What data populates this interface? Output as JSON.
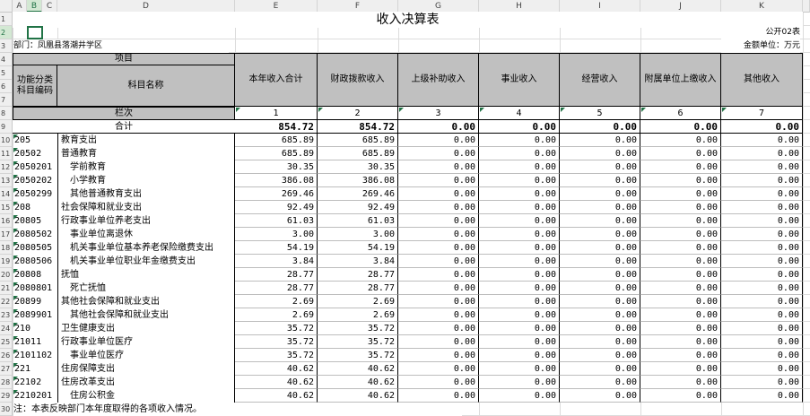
{
  "title": "收入决算表",
  "form_no": "公开02表",
  "dept_label": "部门：凤凰县落潮井学区",
  "unit_label": "金额单位：万元",
  "column_letters": [
    "A",
    "B",
    "C",
    "D",
    "E",
    "F",
    "G",
    "H",
    "I",
    "J",
    "K"
  ],
  "row_numbers": [
    "1",
    "2",
    "3",
    "4",
    "5",
    "6",
    "7",
    "8",
    "9",
    "10",
    "11",
    "12",
    "13",
    "14",
    "15",
    "16",
    "17",
    "18",
    "19",
    "20",
    "21",
    "22",
    "23",
    "24",
    "25",
    "26",
    "27",
    "28",
    "29",
    "30"
  ],
  "headers": {
    "item": "项目",
    "code": "功能分类科目编码",
    "name": "科目名称",
    "cols": [
      "本年收入合计",
      "财政拨款收入",
      "上级补助收入",
      "事业收入",
      "经营收入",
      "附属单位上缴收入",
      "其他收入"
    ]
  },
  "index_row": {
    "label": "栏次",
    "values": [
      "1",
      "2",
      "3",
      "4",
      "5",
      "6",
      "7"
    ]
  },
  "total_row": {
    "label": "合计",
    "values": [
      "854.72",
      "854.72",
      "0.00",
      "0.00",
      "0.00",
      "0.00",
      "0.00"
    ]
  },
  "rows": [
    {
      "code": "205",
      "name": "教育支出",
      "indent": 0,
      "values": [
        "685.89",
        "685.89",
        "0.00",
        "0.00",
        "0.00",
        "0.00",
        "0.00"
      ]
    },
    {
      "code": "20502",
      "name": "普通教育",
      "indent": 0,
      "values": [
        "685.89",
        "685.89",
        "0.00",
        "0.00",
        "0.00",
        "0.00",
        "0.00"
      ]
    },
    {
      "code": "2050201",
      "name": "学前教育",
      "indent": 1,
      "values": [
        "30.35",
        "30.35",
        "0.00",
        "0.00",
        "0.00",
        "0.00",
        "0.00"
      ]
    },
    {
      "code": "2050202",
      "name": "小学教育",
      "indent": 1,
      "values": [
        "386.08",
        "386.08",
        "0.00",
        "0.00",
        "0.00",
        "0.00",
        "0.00"
      ]
    },
    {
      "code": "2050299",
      "name": "其他普通教育支出",
      "indent": 1,
      "values": [
        "269.46",
        "269.46",
        "0.00",
        "0.00",
        "0.00",
        "0.00",
        "0.00"
      ]
    },
    {
      "code": "208",
      "name": "社会保障和就业支出",
      "indent": 0,
      "values": [
        "92.49",
        "92.49",
        "0.00",
        "0.00",
        "0.00",
        "0.00",
        "0.00"
      ]
    },
    {
      "code": "20805",
      "name": "行政事业单位养老支出",
      "indent": 0,
      "values": [
        "61.03",
        "61.03",
        "0.00",
        "0.00",
        "0.00",
        "0.00",
        "0.00"
      ]
    },
    {
      "code": "2080502",
      "name": "事业单位离退休",
      "indent": 1,
      "values": [
        "3.00",
        "3.00",
        "0.00",
        "0.00",
        "0.00",
        "0.00",
        "0.00"
      ]
    },
    {
      "code": "2080505",
      "name": "机关事业单位基本养老保险缴费支出",
      "indent": 1,
      "values": [
        "54.19",
        "54.19",
        "0.00",
        "0.00",
        "0.00",
        "0.00",
        "0.00"
      ]
    },
    {
      "code": "2080506",
      "name": "机关事业单位职业年金缴费支出",
      "indent": 1,
      "values": [
        "3.84",
        "3.84",
        "0.00",
        "0.00",
        "0.00",
        "0.00",
        "0.00"
      ]
    },
    {
      "code": "20808",
      "name": "抚恤",
      "indent": 0,
      "values": [
        "28.77",
        "28.77",
        "0.00",
        "0.00",
        "0.00",
        "0.00",
        "0.00"
      ]
    },
    {
      "code": "2080801",
      "name": "死亡抚恤",
      "indent": 1,
      "values": [
        "28.77",
        "28.77",
        "0.00",
        "0.00",
        "0.00",
        "0.00",
        "0.00"
      ]
    },
    {
      "code": "20899",
      "name": "其他社会保障和就业支出",
      "indent": 0,
      "values": [
        "2.69",
        "2.69",
        "0.00",
        "0.00",
        "0.00",
        "0.00",
        "0.00"
      ]
    },
    {
      "code": "2089901",
      "name": "其他社会保障和就业支出",
      "indent": 1,
      "values": [
        "2.69",
        "2.69",
        "0.00",
        "0.00",
        "0.00",
        "0.00",
        "0.00"
      ]
    },
    {
      "code": "210",
      "name": "卫生健康支出",
      "indent": 0,
      "values": [
        "35.72",
        "35.72",
        "0.00",
        "0.00",
        "0.00",
        "0.00",
        "0.00"
      ]
    },
    {
      "code": "21011",
      "name": "行政事业单位医疗",
      "indent": 0,
      "values": [
        "35.72",
        "35.72",
        "0.00",
        "0.00",
        "0.00",
        "0.00",
        "0.00"
      ]
    },
    {
      "code": "2101102",
      "name": "事业单位医疗",
      "indent": 1,
      "values": [
        "35.72",
        "35.72",
        "0.00",
        "0.00",
        "0.00",
        "0.00",
        "0.00"
      ]
    },
    {
      "code": "221",
      "name": "住房保障支出",
      "indent": 0,
      "values": [
        "40.62",
        "40.62",
        "0.00",
        "0.00",
        "0.00",
        "0.00",
        "0.00"
      ]
    },
    {
      "code": "22102",
      "name": "住房改革支出",
      "indent": 0,
      "values": [
        "40.62",
        "40.62",
        "0.00",
        "0.00",
        "0.00",
        "0.00",
        "0.00"
      ]
    },
    {
      "code": "2210201",
      "name": "住房公积金",
      "indent": 1,
      "values": [
        "40.62",
        "40.62",
        "0.00",
        "0.00",
        "0.00",
        "0.00",
        "0.00"
      ]
    }
  ],
  "note": "注：本表反映部门本年度取得的各项收入情况。",
  "colors": {
    "accent": "#217346",
    "header_fill": "#c0c0c0",
    "gridline": "#dcdcdc"
  }
}
